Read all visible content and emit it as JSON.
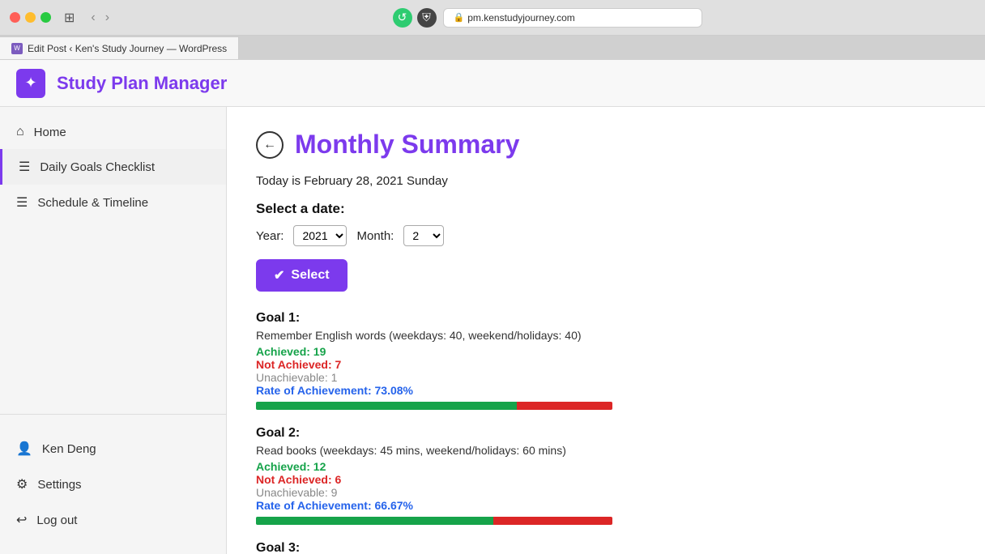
{
  "mac": {
    "traffic_lights": [
      "red",
      "yellow",
      "green"
    ],
    "address": "pm.kenstudyjourney.com"
  },
  "tab": {
    "label": "Edit Post ‹ Ken's Study Journey — WordPress"
  },
  "app": {
    "logo_symbol": "✦",
    "title": "Study Plan Manager"
  },
  "sidebar": {
    "items": [
      {
        "id": "home",
        "label": "Home",
        "icon": "⌂"
      },
      {
        "id": "daily-goals",
        "label": "Daily Goals Checklist",
        "icon": "☰",
        "active": true
      },
      {
        "id": "schedule",
        "label": "Schedule & Timeline",
        "icon": "☰"
      }
    ],
    "bottom_items": [
      {
        "id": "user",
        "label": "Ken Deng",
        "icon": "👤"
      },
      {
        "id": "settings",
        "label": "Settings",
        "icon": "⚙"
      },
      {
        "id": "logout",
        "label": "Log out",
        "icon": "↩"
      }
    ]
  },
  "main": {
    "back_button_symbol": "←",
    "page_title": "Monthly Summary",
    "today_label": "Today is February 28, 2021 Sunday",
    "select_date_label": "Select a date:",
    "year_label": "Year:",
    "year_value": "2021",
    "month_label": "Month:",
    "month_value": "2",
    "select_button_label": "Select",
    "goals": [
      {
        "title": "Goal 1:",
        "description": "Remember English words (weekdays: 40, weekend/holidays: 40)",
        "achieved": "Achieved: 19",
        "not_achieved": "Not Achieved: 7",
        "unachievable": "Unachievable: 1",
        "rate": "Rate of Achievement: 73.08%",
        "green_pct": 73.08,
        "red_pct": 26.92
      },
      {
        "title": "Goal 2:",
        "description": "Read books (weekdays: 45 mins, weekend/holidays: 60 mins)",
        "achieved": "Achieved: 12",
        "not_achieved": "Not Achieved: 6",
        "unachievable": "Unachievable: 9",
        "rate": "Rate of Achievement: 66.67%",
        "green_pct": 66.67,
        "red_pct": 33.33
      },
      {
        "title": "Goal 3:",
        "description": "",
        "achieved": "",
        "not_achieved": "",
        "unachievable": "",
        "rate": "",
        "green_pct": 0,
        "red_pct": 0
      }
    ]
  }
}
